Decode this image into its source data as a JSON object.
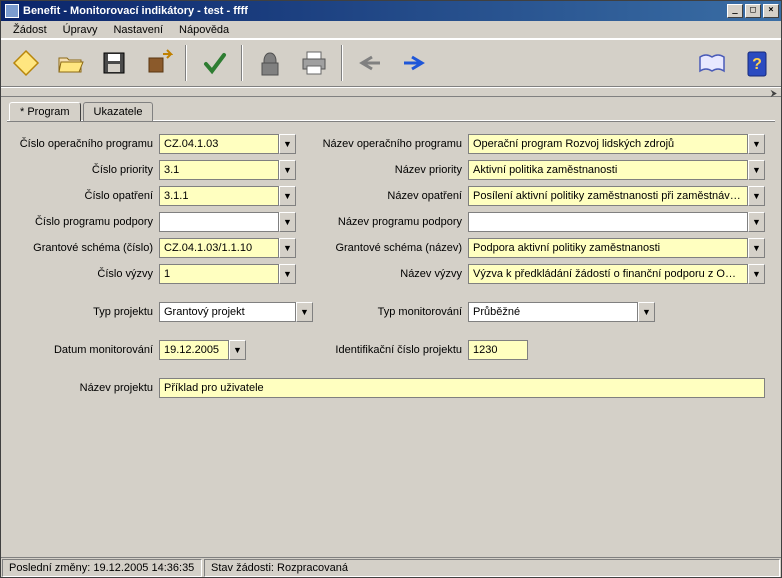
{
  "window": {
    "title": "Benefit - Monitorovací indikátory - test - ffff"
  },
  "menus": {
    "zadost": "Žádost",
    "upravy": "Úpravy",
    "nastaveni": "Nastavení",
    "napoveda": "Nápověda"
  },
  "tabs": {
    "program": "* Program",
    "ukazatele": "Ukazatele"
  },
  "labels": {
    "cislo_op": "Číslo operačního programu",
    "nazev_op": "Název operačního programu",
    "cislo_priority": "Číslo priority",
    "nazev_priority": "Název priority",
    "cislo_opatreni": "Číslo opatření",
    "nazev_opatreni": "Název opatření",
    "cislo_prog_podpory": "Číslo programu podpory",
    "nazev_prog_podpory": "Název programu podpory",
    "grant_schema_cislo": "Grantové schéma (číslo)",
    "grant_schema_nazev": "Grantové schéma (název)",
    "cislo_vyzvy": "Číslo výzvy",
    "nazev_vyzvy": "Název výzvy",
    "typ_projektu": "Typ projektu",
    "typ_monitorovani": "Typ monitorování",
    "datum_monitorovani": "Datum monitorování",
    "id_cislo_projektu": "Identifikační číslo projektu",
    "nazev_projektu": "Název projektu"
  },
  "values": {
    "cislo_op": "CZ.04.1.03",
    "nazev_op": "Operační program Rozvoj lidských zdrojů",
    "cislo_priority": "3.1",
    "nazev_priority": "Aktivní politika zaměstnanosti",
    "cislo_opatreni": "3.1.1",
    "nazev_opatreni": "Posílení aktivní politiky zaměstnanosti při zaměstnávání uc",
    "cislo_prog_podpory": "",
    "nazev_prog_podpory": "",
    "grant_schema_cislo": "CZ.04.1.03/1.1.10",
    "grant_schema_nazev": "Podpora aktivní politiky zaměstnanosti",
    "cislo_vyzvy": "1",
    "nazev_vyzvy": "Výzva k předkládání žádostí o finanční podporu z OP RLZ",
    "typ_projektu": "Grantový projekt",
    "typ_monitorovani": "Průběžné",
    "datum_monitorovani": "19.12.2005",
    "id_cislo_projektu": "1230",
    "nazev_projektu": "Příklad pro uživatele"
  },
  "status": {
    "last_change": "Poslední změny: 19.12.2005 14:36:35",
    "stav": "Stav žádosti: Rozpracovaná"
  }
}
